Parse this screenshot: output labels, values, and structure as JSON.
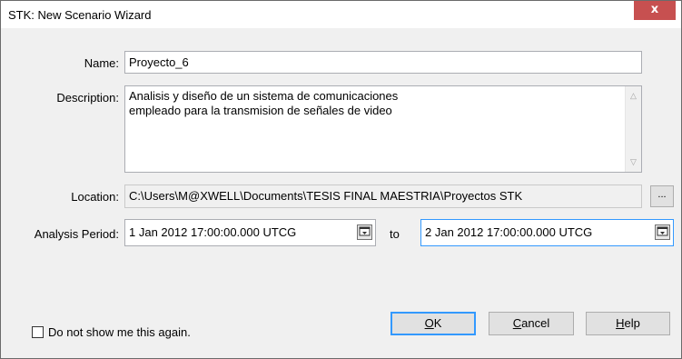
{
  "window": {
    "title": "STK: New Scenario Wizard",
    "close_label": "x"
  },
  "form": {
    "name_label": "Name:",
    "name_value": "Proyecto_6",
    "description_label": "Description:",
    "description_lines": [
      "Analisis y diseño de un sistema de comunicaciones",
      "empleado para la transmision de señales de video"
    ],
    "location_label": "Location:",
    "location_value": "C:\\Users\\M@XWELL\\Documents\\TESIS FINAL MAESTRIA\\Proyectos STK",
    "browse_label": "...",
    "period_label": "Analysis Period:",
    "start_value": "1 Jan 2012 17:00:00.000 UTCG",
    "to_label": "to",
    "end_value": "2 Jan 2012 17:00:00.000 UTCG"
  },
  "footer": {
    "dont_show_label": "Do not show me this again.",
    "dont_show_checked": false,
    "ok_mnemonic": "O",
    "ok_rest": "K",
    "cancel_mnemonic": "C",
    "cancel_rest": "ancel",
    "help_mnemonic": "H",
    "help_rest": "elp"
  },
  "colors": {
    "close_button": "#c75050",
    "focus_border": "#3399ff",
    "dialog_background": "#f0f0f0"
  }
}
